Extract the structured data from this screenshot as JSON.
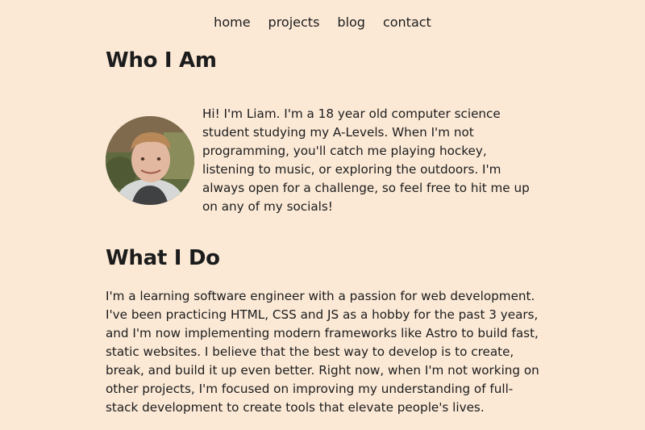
{
  "nav": {
    "items": [
      {
        "label": "home"
      },
      {
        "label": "projects"
      },
      {
        "label": "blog"
      },
      {
        "label": "contact"
      }
    ]
  },
  "who": {
    "title": "Who I Am",
    "text": "Hi! I'm Liam. I'm a 18 year old computer science student studying my A-Levels. When I'm not programming, you'll catch me playing hockey, listening to music, or exploring the outdoors. I'm always open for a challenge, so feel free to hit me up on any of my socials!"
  },
  "what": {
    "title": "What I Do",
    "text": "I'm a learning software engineer with a passion for web development. I've been practicing HTML, CSS and JS as a hobby for the past 3 years, and I'm now implementing modern frameworks like Astro to build fast, static websites. I believe that the best way to develop is to create, break, and build it up even better. Right now, when I'm not working on other projects, I'm focused on improving my understanding of full-stack development to create tools that elevate people's lives."
  },
  "colors": {
    "background": "#fbe9d6",
    "text": "#1c1c1c"
  }
}
